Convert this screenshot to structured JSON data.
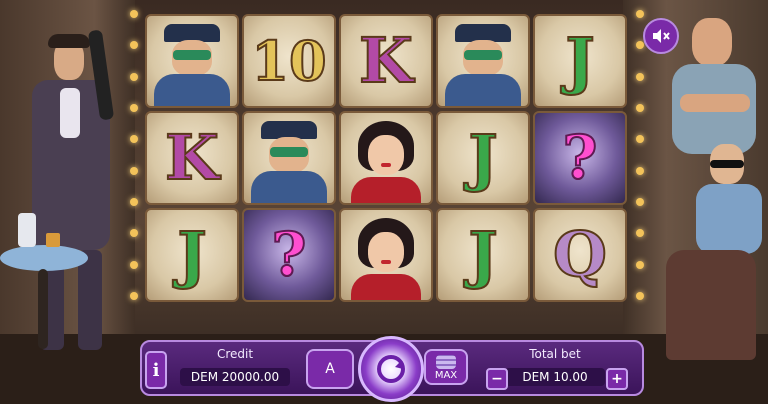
{
  "reels": [
    [
      "cop",
      "10",
      "K",
      "cop",
      "J"
    ],
    [
      "K",
      "cop",
      "lady",
      "J",
      "?"
    ],
    [
      "J",
      "?",
      "lady",
      "J",
      "Q"
    ]
  ],
  "controls": {
    "info_label": "i",
    "credit_label": "Credit",
    "credit_value": "DEM 20000.00",
    "autoplay_label": "A",
    "spin_icon": "spin-arrow",
    "max_label": "MAX",
    "total_bet_label": "Total bet",
    "total_bet_value": "DEM 10.00",
    "minus_label": "−",
    "plus_label": "+"
  },
  "mute_icon": "speaker-muted-icon"
}
